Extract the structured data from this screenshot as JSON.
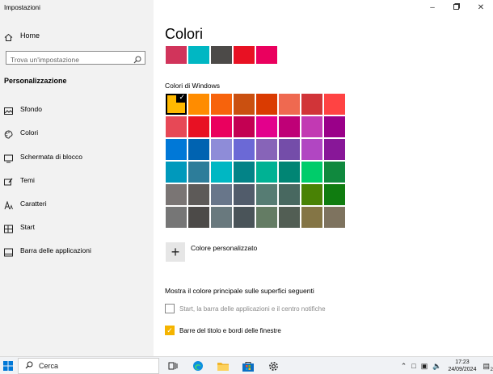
{
  "window": {
    "title": "Impostazioni"
  },
  "sidebar": {
    "home_label": "Home",
    "search_placeholder": "Trova un'impostazione",
    "section_title": "Personalizzazione",
    "items": [
      {
        "label": "Sfondo",
        "icon": "image-icon"
      },
      {
        "label": "Colori",
        "icon": "palette-icon"
      },
      {
        "label": "Schermata di blocco",
        "icon": "monitor-icon"
      },
      {
        "label": "Temi",
        "icon": "brush-icon"
      },
      {
        "label": "Caratteri",
        "icon": "font-icon"
      },
      {
        "label": "Start",
        "icon": "start-grid-icon"
      },
      {
        "label": "Barra delle applicazioni",
        "icon": "taskbar-icon"
      }
    ]
  },
  "main": {
    "title": "Colori",
    "recent_colors": [
      "#d1345b",
      "#00b7c3",
      "#4c4a48",
      "#e81123",
      "#ea005e"
    ],
    "windows_colors_label": "Colori di Windows",
    "windows_colors": [
      "#ffb900",
      "#ff8c00",
      "#f7630c",
      "#ca5010",
      "#da3b01",
      "#ef6950",
      "#d13438",
      "#ff4343",
      "#e74856",
      "#e81123",
      "#ea005e",
      "#c30052",
      "#e3008c",
      "#bf0077",
      "#c239b3",
      "#9a0089",
      "#0078d7",
      "#0063b1",
      "#8e8cd8",
      "#6b69d6",
      "#8764b8",
      "#744da9",
      "#b146c2",
      "#881798",
      "#0099bc",
      "#2d7d9a",
      "#00b7c3",
      "#038387",
      "#00b294",
      "#018574",
      "#00cc6a",
      "#10893e",
      "#7a7574",
      "#5d5a58",
      "#68768a",
      "#515c6b",
      "#567c73",
      "#486860",
      "#498205",
      "#107c10",
      "#767676",
      "#4c4a48",
      "#69797e",
      "#4a5459",
      "#647c64",
      "#525e54",
      "#847545",
      "#7e735f"
    ],
    "selected_index": 0,
    "custom_color_label": "Colore personalizzato",
    "surfaces_label": "Mostra il colore principale sulle superfici seguenti",
    "surface_options": [
      {
        "label": "Start, la barra delle applicazioni e il centro notifiche",
        "checked": false
      },
      {
        "label": "Barre del titolo e bordi delle finestre",
        "checked": true
      }
    ]
  },
  "taskbar": {
    "search_label": "Cerca",
    "pinned": [
      "task-view-icon",
      "edge-icon",
      "file-explorer-icon",
      "store-icon",
      "settings-icon"
    ],
    "time": "17:23",
    "date": "24/09/2024",
    "notification_count": "2"
  }
}
